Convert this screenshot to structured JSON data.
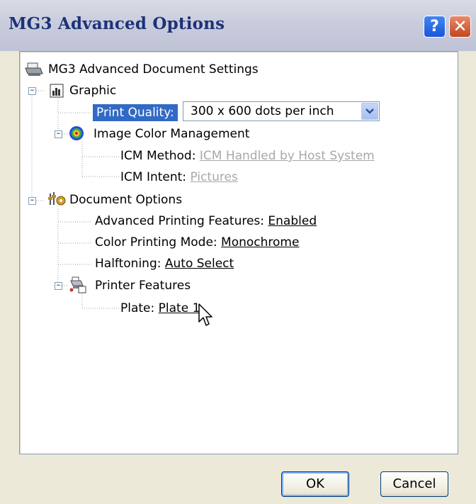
{
  "window": {
    "title": "MG3 Advanced Options",
    "help_label": "?",
    "close_label": "✕"
  },
  "tree": {
    "root_label": "MG3 Advanced Document Settings",
    "graphic_label": "Graphic",
    "print_quality_label": "Print Quality:",
    "print_quality_value": "300 x 600 dots per inch",
    "icm_label": "Image Color Management",
    "icm_method_label": "ICM Method:",
    "icm_method_value": "ICM Handled by Host System",
    "icm_intent_label": "ICM Intent:",
    "icm_intent_value": "Pictures",
    "doc_options_label": "Document Options",
    "adv_printing_label": "Advanced Printing Features:",
    "adv_printing_value": "Enabled",
    "color_mode_label": "Color Printing Mode:",
    "color_mode_value": "Monochrome",
    "halftoning_label": "Halftoning:",
    "halftoning_value": "Auto Select",
    "printer_features_label": "Printer Features",
    "plate_label": "Plate:",
    "plate_value": "Plate 1"
  },
  "buttons": {
    "ok_label": "OK",
    "cancel_label": "Cancel"
  },
  "colors": {
    "title_text": "#1c3278",
    "selection": "#316ac5",
    "disabled_value": "#a8a8a8"
  }
}
